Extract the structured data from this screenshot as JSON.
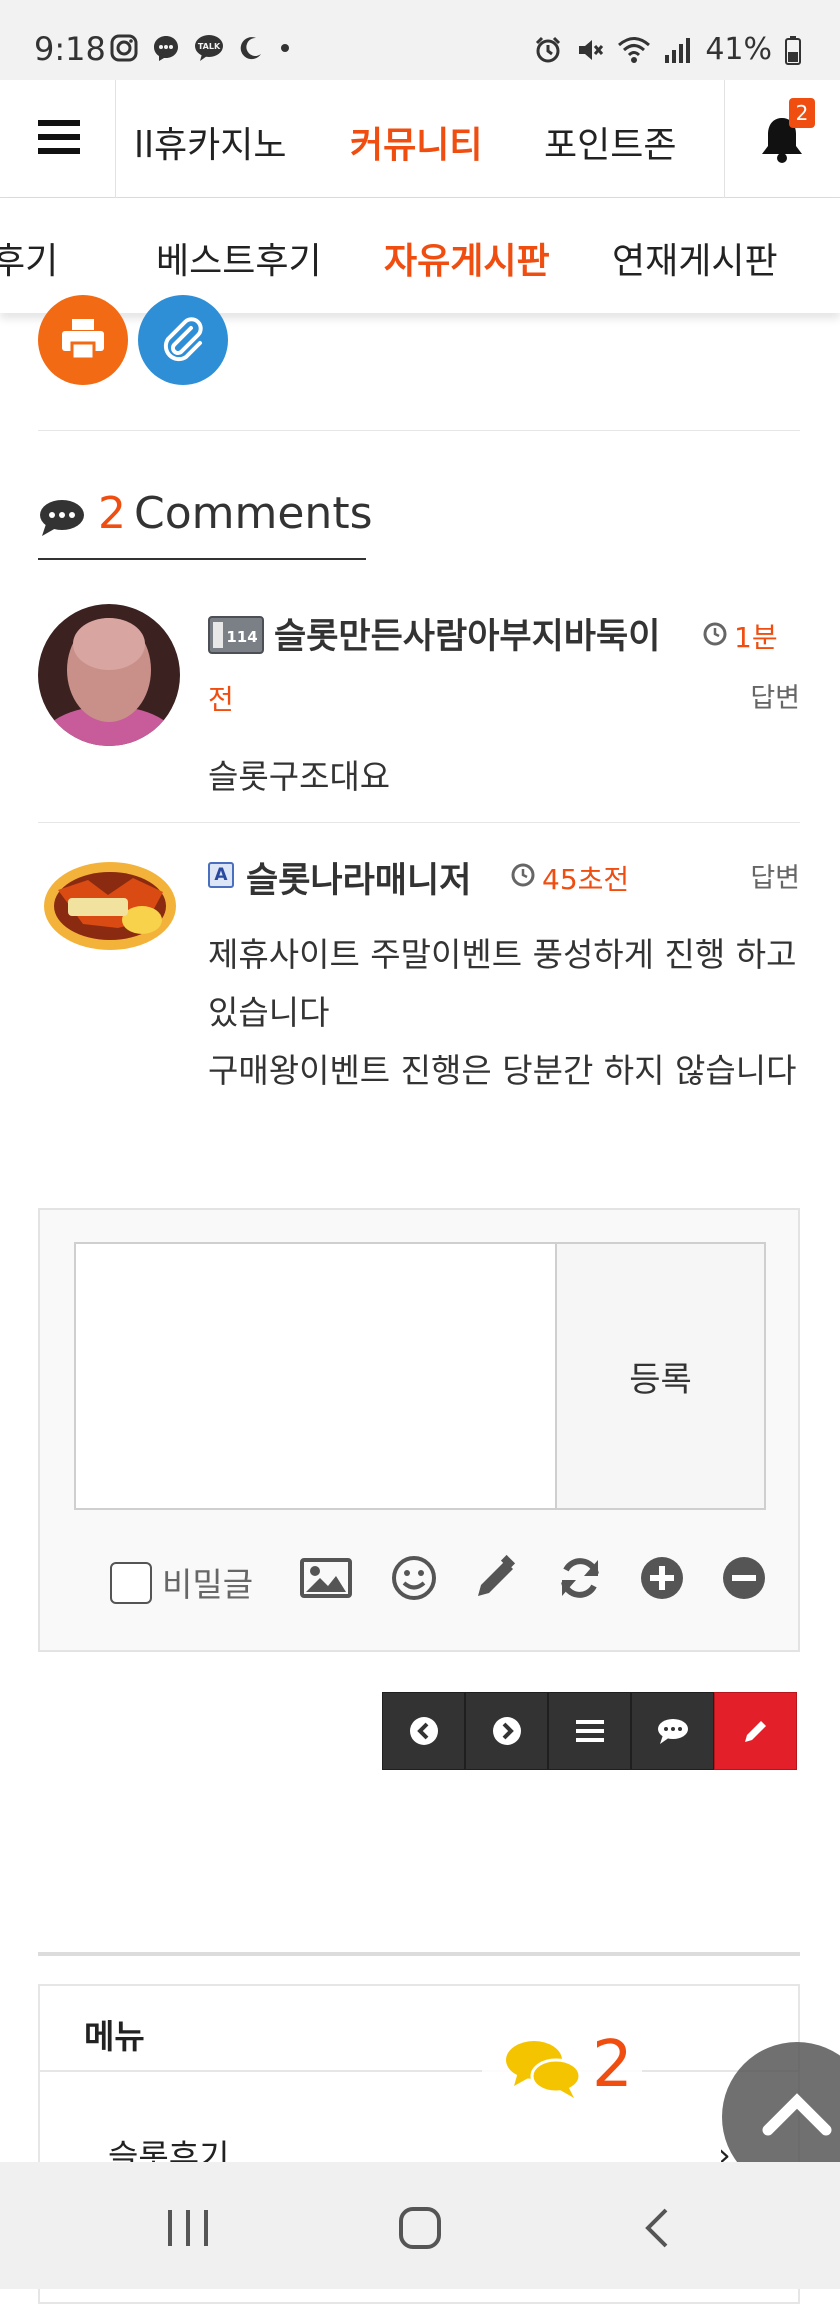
{
  "status_bar": {
    "time": "9:18",
    "battery": "41%",
    "icons_left": [
      "instagram-icon",
      "messenger-icon",
      "kakaotalk-icon",
      "moon-icon",
      "dot-icon"
    ],
    "icons_right": [
      "alarm-icon",
      "mute-icon",
      "wifi-icon",
      "signal-icon",
      "battery-icon"
    ]
  },
  "top_nav": {
    "items": [
      {
        "label": "ll휴카지노",
        "active": false
      },
      {
        "label": "커뮤니티",
        "active": true
      },
      {
        "label": "포인트존",
        "active": false
      }
    ],
    "notification_count": "2"
  },
  "sub_nav": {
    "items": [
      {
        "label": "후기",
        "active": false
      },
      {
        "label": "베스트후기",
        "active": false
      },
      {
        "label": "자유게시판",
        "active": true
      },
      {
        "label": "연재게시판",
        "active": false
      }
    ]
  },
  "share": {
    "print_icon": "print-icon",
    "attach_icon": "paperclip-icon"
  },
  "comments": {
    "count": "2",
    "label": "Comments",
    "items": [
      {
        "level_badge": "lv.114",
        "author": "슬롯만든사람아부지바둑이",
        "time_part1": "1분",
        "time_part2": "전",
        "reply_label": "답변",
        "body": "슬롯구조대요"
      },
      {
        "level_badge": "A",
        "author": "슬롯나라매니저",
        "time": "45초전",
        "reply_label": "답변",
        "body_line1": "제휴사이트 주말이벤트 풍성하게 진행 하고 있습니다",
        "body_line2": "구매왕이벤트 진행은 당분간 하지 않습니다"
      }
    ]
  },
  "comment_form": {
    "textarea_value": "",
    "submit_label": "등록",
    "secret_label": "비밀글",
    "secret_checked": false,
    "tools": [
      "image-icon",
      "emoji-icon",
      "pencil-icon",
      "refresh-icon",
      "plus-circle-icon",
      "minus-circle-icon"
    ]
  },
  "pagination": [
    "prev-icon",
    "next-icon",
    "list-icon",
    "comment-icon",
    "write-icon"
  ],
  "colors": {
    "accent": "#f04e11",
    "write_button": "#e3202a",
    "dark_button": "#333333"
  },
  "footer_menu": {
    "title": "메뉴",
    "items": [
      {
        "label": "슬롯후기",
        "arrow": "›"
      }
    ],
    "floating_comment_count": "2"
  }
}
